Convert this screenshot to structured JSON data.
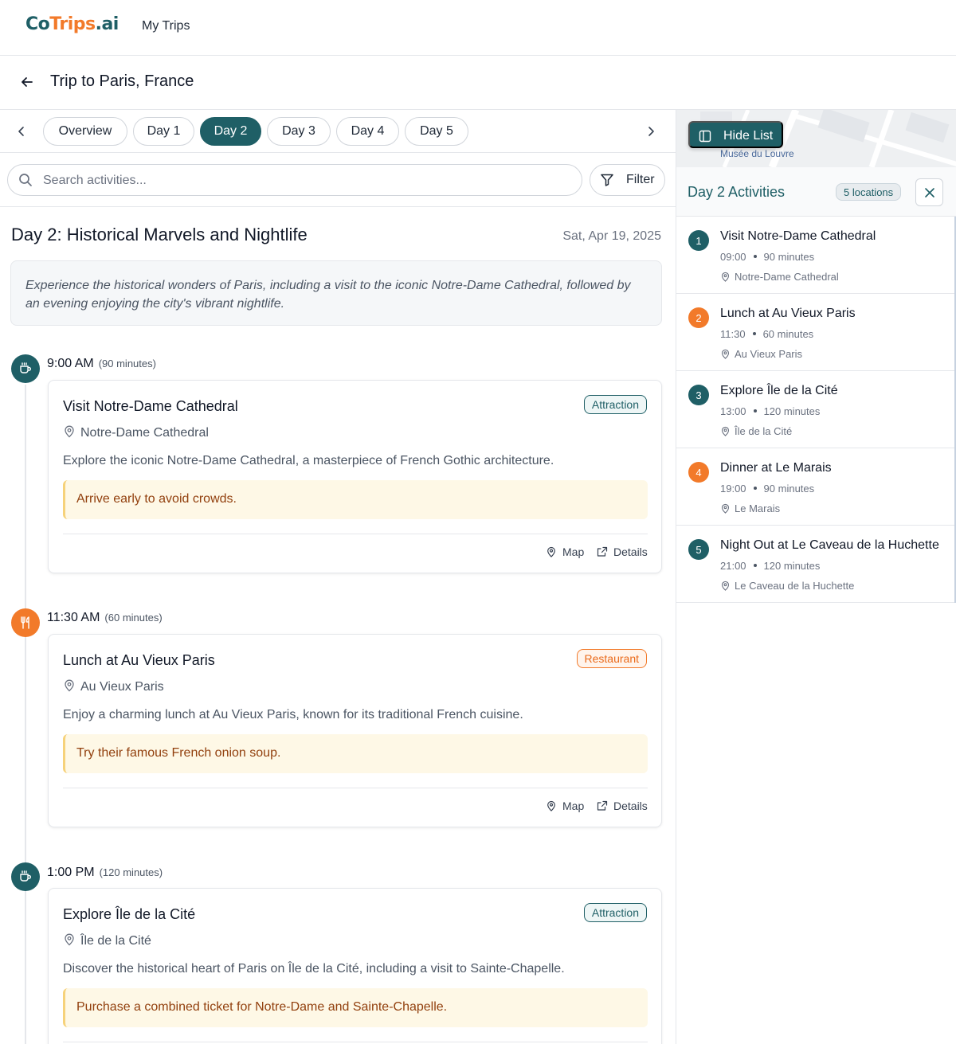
{
  "brand": {
    "part1": "Co",
    "part2": "Trips",
    "part3": ".ai"
  },
  "nav": {
    "my_trips": "My Trips"
  },
  "trip": {
    "title": "Trip to Paris, France"
  },
  "tabs": [
    "Overview",
    "Day 1",
    "Day 2",
    "Day 3",
    "Day 4",
    "Day 5"
  ],
  "active_tab": "Day 2",
  "search": {
    "placeholder": "Search activities..."
  },
  "filter": {
    "label": "Filter"
  },
  "day": {
    "title": "Day 2: Historical Marvels and Nightlife",
    "date": "Sat, Apr 19, 2025",
    "description": "Experience the historical wonders of Paris, including a visit to the iconic Notre-Dame Cathedral, followed by an evening enjoying the city's vibrant nightlife."
  },
  "timeline": [
    {
      "time": "9:00 AM",
      "duration": "(90 minutes)",
      "icon": "coffee-icon",
      "title": "Visit Notre-Dame Cathedral",
      "badge": "Attraction",
      "location": "Notre-Dame Cathedral",
      "description": "Explore the iconic Notre-Dame Cathedral, a masterpiece of French Gothic architecture.",
      "tip": "Arrive early to avoid crowds."
    },
    {
      "time": "11:30 AM",
      "duration": "(60 minutes)",
      "icon": "utensils-icon",
      "title": "Lunch at Au Vieux Paris",
      "badge": "Restaurant",
      "location": "Au Vieux Paris",
      "description": "Enjoy a charming lunch at Au Vieux Paris, known for its traditional French cuisine.",
      "tip": "Try their famous French onion soup."
    },
    {
      "time": "1:00 PM",
      "duration": "(120 minutes)",
      "icon": "coffee-icon",
      "title": "Explore Île de la Cité",
      "badge": "Attraction",
      "location": "Île de la Cité",
      "description": "Discover the historical heart of Paris on Île de la Cité, including a visit to Sainte-Chapelle.",
      "tip": "Purchase a combined ticket for Notre-Dame and Sainte-Chapelle."
    }
  ],
  "card_actions": {
    "map": "Map",
    "details": "Details"
  },
  "panel": {
    "hide_list": "Hide List",
    "map_label": "Musée du Louvre",
    "title": "Day 2 Activities",
    "count": "5 locations",
    "activities": [
      {
        "num": "1",
        "name": "Visit Notre-Dame Cathedral",
        "time": "09:00",
        "duration": "90 minutes",
        "location": "Notre-Dame Cathedral"
      },
      {
        "num": "2",
        "name": "Lunch at Au Vieux Paris",
        "time": "11:30",
        "duration": "60 minutes",
        "location": "Au Vieux Paris"
      },
      {
        "num": "3",
        "name": "Explore Île de la Cité",
        "time": "13:00",
        "duration": "120 minutes",
        "location": "Île de la Cité"
      },
      {
        "num": "4",
        "name": "Dinner at Le Marais",
        "time": "19:00",
        "duration": "90 minutes",
        "location": "Le Marais"
      },
      {
        "num": "5",
        "name": "Night Out at Le Caveau de la Huchette",
        "time": "21:00",
        "duration": "120 minutes",
        "location": "Le Caveau de la Huchette"
      }
    ]
  },
  "colors": {
    "primary": "#1f5f66",
    "accent": "#f27a2a",
    "tip_bg": "#fef8e6",
    "tip_text": "#92400e"
  }
}
